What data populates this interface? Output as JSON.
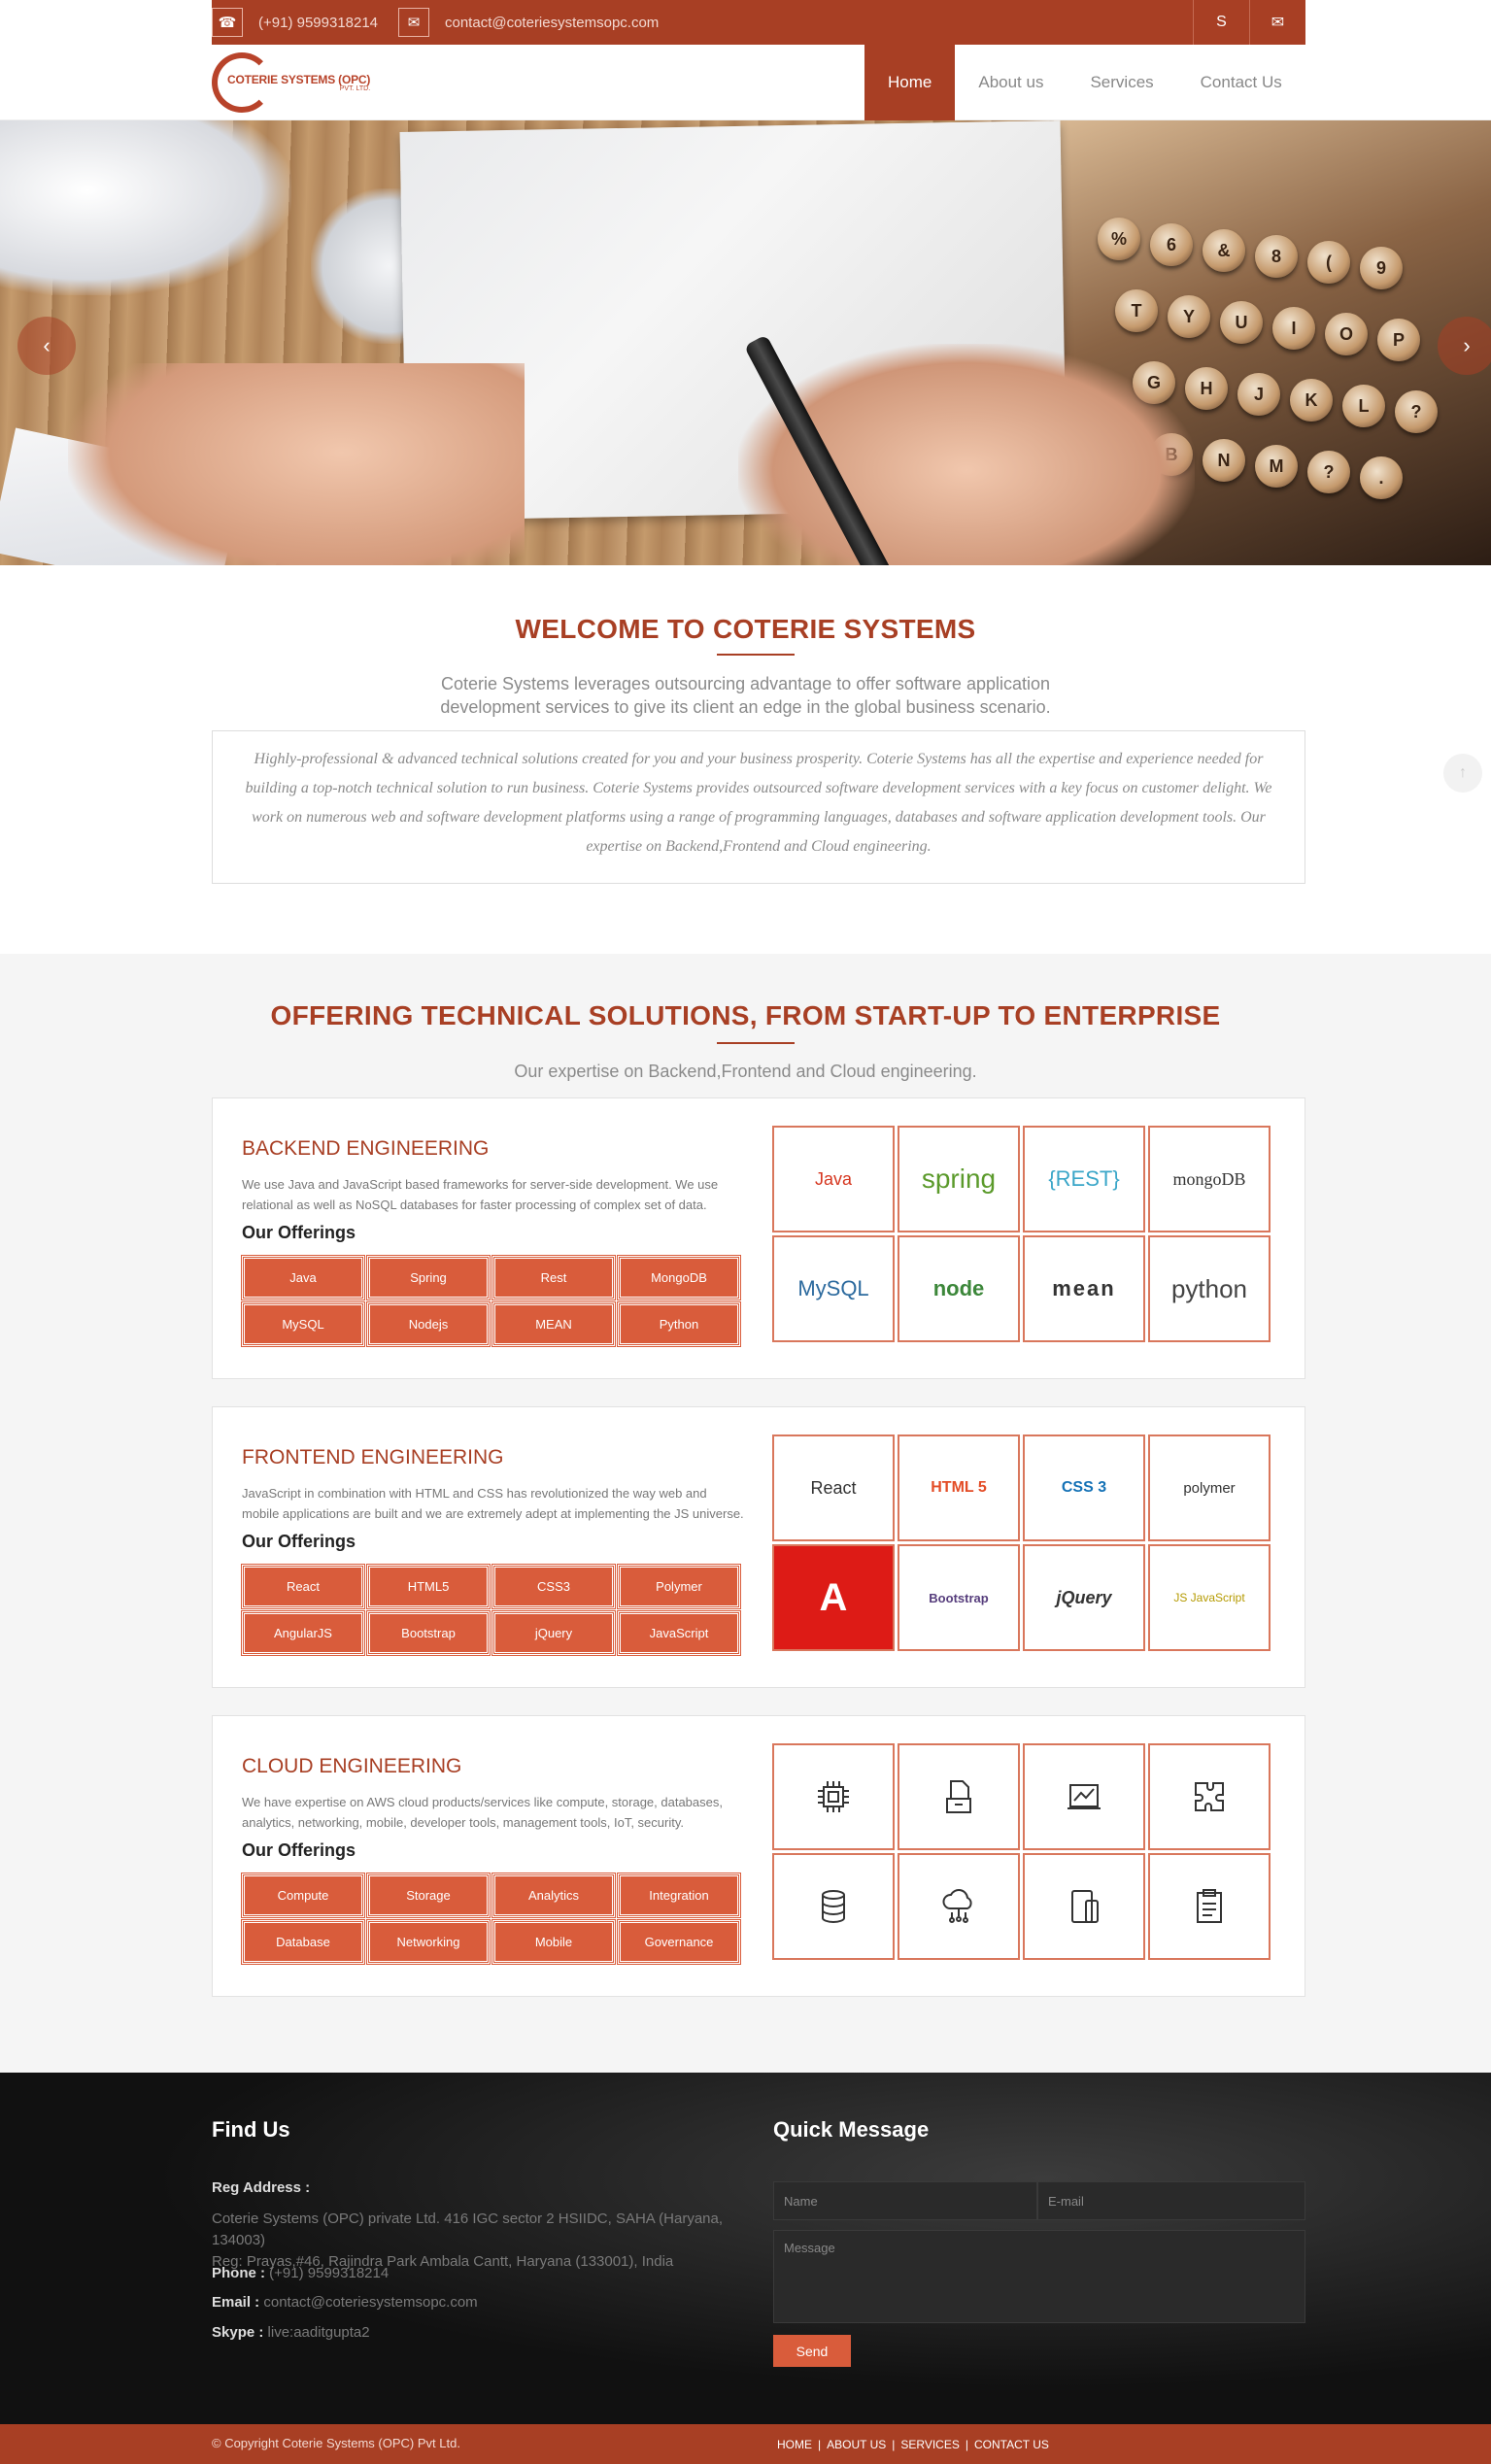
{
  "topbar": {
    "phone": "(+91) 9599318214",
    "email": "contact@coteriesystemsopc.com"
  },
  "logo": {
    "name": "COTERIE SYSTEMS (OPC)",
    "sub": "PVT. LTD."
  },
  "nav": {
    "items": [
      "Home",
      "About us",
      "Services",
      "Contact Us"
    ],
    "active": "Home"
  },
  "hero": {
    "keys_row1": [
      "%",
      "6",
      "&",
      "8",
      "(",
      "9"
    ],
    "keys_row2": [
      "T",
      "Y",
      "U",
      "I",
      "O",
      "P"
    ],
    "keys_row3": [
      "G",
      "H",
      "J",
      "K",
      "L",
      "?"
    ],
    "keys_row4": [
      "B",
      "N",
      "M",
      "?",
      "."
    ]
  },
  "welcome": {
    "title": "WELCOME TO COTERIE SYSTEMS",
    "lead_1": "Coterie Systems leverages outsourcing advantage to offer software application",
    "lead_2": "development services to give its client an edge in the global business scenario.",
    "body": "Highly-professional & advanced technical solutions created for you and your business prosperity. Coterie Systems has all the expertise and experience needed for building a top-notch technical solution to run business. Coterie Systems provides outsourced software development services with a key focus on customer delight. We work on numerous web and software development platforms using a range of programming languages, databases and software application development tools. Our expertise on Backend,Frontend and Cloud engineering."
  },
  "offering": {
    "title": "OFFERING TECHNICAL SOLUTIONS, FROM START-UP TO ENTERPRISE",
    "subtitle": "Our expertise on Backend,Frontend and Cloud engineering."
  },
  "backend": {
    "title": "BACKEND ENGINEERING",
    "desc": "We use Java and JavaScript based frameworks for server-side development. We use relational as well as NoSQL databases for faster processing of complex set of data.",
    "offer_title": "Our Offerings",
    "offers": [
      "Java",
      "Spring",
      "Rest",
      "MongoDB",
      "MySQL",
      "Nodejs",
      "MEAN",
      "Python"
    ],
    "logos": [
      "Java",
      "spring",
      "{REST}",
      "mongoDB",
      "MySQL",
      "node",
      "mean",
      "python"
    ]
  },
  "frontend": {
    "title": "FRONTEND ENGINEERING",
    "desc": "JavaScript in combination with HTML and CSS has revolutionized the way web and mobile applications are built and we are extremely adept at implementing the JS universe.",
    "offer_title": "Our Offerings",
    "offers": [
      "React",
      "HTML5",
      "CSS3",
      "Polymer",
      "AngularJS",
      "Bootstrap",
      "jQuery",
      "JavaScript"
    ],
    "logos": [
      "React",
      "HTML 5",
      "CSS 3",
      "polymer",
      "A",
      "Bootstrap",
      "jQuery",
      "JS JavaScript"
    ]
  },
  "cloud": {
    "title": "CLOUD ENGINEERING",
    "desc": "We have expertise on AWS cloud products/services like compute, storage, databases, analytics, networking, mobile, developer tools, management tools, IoT, security.",
    "offer_title": "Our Offerings",
    "offers": [
      "Compute",
      "Storage",
      "Analytics",
      "Integration",
      "Database",
      "Networking",
      "Mobile",
      "Governance"
    ]
  },
  "footer": {
    "find_us": "Find Us",
    "reg_label": "Reg Address :",
    "reg_1": "Coterie Systems (OPC) private Ltd. 416 IGC sector 2 HSIIDC, SAHA (Haryana, 134003)",
    "reg_2": "Reg: Prayas,#46, Rajindra Park Ambala Cantt, Haryana (133001), India",
    "phone_label": "Phone :",
    "phone": "(+91) 9599318214",
    "email_label": "Email :",
    "email": "contact@coteriesystemsopc.com",
    "skype_label": "Skype :",
    "skype": "live:aaditgupta2",
    "quick": "Quick Message",
    "name_ph": "Name",
    "email_ph": "E-mail",
    "message_ph": "Message",
    "send": "Send",
    "copyright": "© Copyright Coterie Systems (OPC) Pvt Ltd.",
    "links": [
      "HOME",
      "ABOUT US",
      "SERVICES",
      "CONTACT US"
    ]
  }
}
